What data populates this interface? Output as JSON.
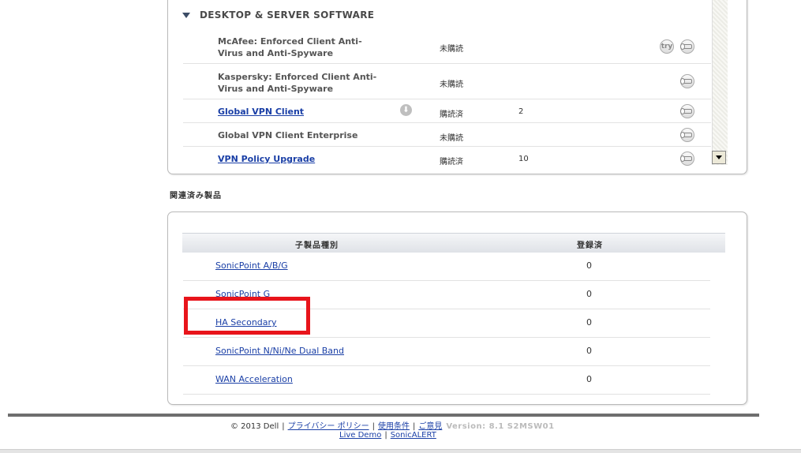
{
  "section": {
    "title": "DESKTOP & SERVER SOFTWARE"
  },
  "software": [
    {
      "name": "McAfee: Enforced Client Anti-Virus and Anti-Spyware",
      "status": "未購読",
      "count": "",
      "link": false,
      "try": "try",
      "download": false
    },
    {
      "name": "Kaspersky: Enforced Client Anti-Virus and Anti-Spyware",
      "status": "未購読",
      "count": "",
      "link": false,
      "try": "",
      "download": false
    },
    {
      "name": "Global VPN Client",
      "status": "購読済",
      "count": "2",
      "link": true,
      "try": "",
      "download": true
    },
    {
      "name": "Global VPN Client Enterprise",
      "status": "未購読",
      "count": "",
      "link": false,
      "try": "",
      "download": false
    },
    {
      "name": "VPN Policy Upgrade",
      "status": "購読済",
      "count": "10",
      "link": true,
      "try": "",
      "download": false
    }
  ],
  "linked": {
    "title": "関連済み製品",
    "columns": {
      "type": "子製品種別",
      "registered": "登録済"
    },
    "rows": [
      {
        "name": "SonicPoint A/B/G",
        "count": "0"
      },
      {
        "name": "SonicPoint G",
        "count": "0"
      },
      {
        "name": "HA Secondary",
        "count": "0"
      },
      {
        "name": "SonicPoint N/Ni/Ne Dual Band",
        "count": "0"
      },
      {
        "name": "WAN Acceleration",
        "count": "0"
      }
    ]
  },
  "footer": {
    "copyright": "© 2013 Dell",
    "privacy": "プライバシー ポリシー",
    "terms": "使用条件",
    "feedback": "ご意見",
    "version": "Version: 8.1  S2MSW01",
    "live_demo": "Live Demo",
    "sonicalert": "SonicALERT",
    "divider": "|"
  },
  "colors": {
    "link": "#1a3fa6",
    "highlight": "#e8141b",
    "footer_line": "#6e6e6e"
  }
}
